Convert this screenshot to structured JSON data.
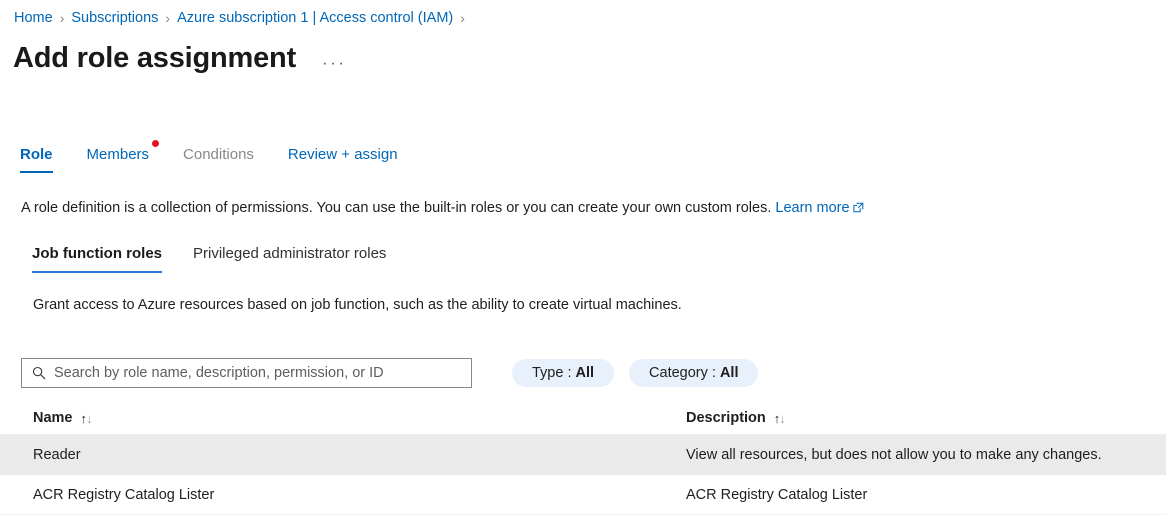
{
  "breadcrumb": {
    "items": [
      {
        "label": "Home"
      },
      {
        "label": "Subscriptions"
      },
      {
        "label": "Azure subscription 1 | Access control (IAM)"
      }
    ],
    "separator": "›"
  },
  "header": {
    "title": "Add role assignment",
    "more_menu": "···"
  },
  "tabs": [
    {
      "label": "Role",
      "state": "selected",
      "badge": false
    },
    {
      "label": "Members",
      "state": "enabled",
      "badge": true
    },
    {
      "label": "Conditions",
      "state": "disabled",
      "badge": false
    },
    {
      "label": "Review + assign",
      "state": "enabled",
      "badge": false
    }
  ],
  "description": {
    "text": "A role definition is a collection of permissions. You can use the built-in roles or you can create your own custom roles.",
    "link_label": "Learn more",
    "link_icon": "external-link-icon"
  },
  "subtabs": [
    {
      "label": "Job function roles",
      "state": "selected"
    },
    {
      "label": "Privileged administrator roles",
      "state": "enabled"
    }
  ],
  "grant_text": "Grant access to Azure resources based on job function, such as the ability to create virtual machines.",
  "search": {
    "placeholder": "Search by role name, description, permission, or ID",
    "value": "",
    "icon": "search-icon"
  },
  "filters": [
    {
      "key": "Type :",
      "value": "All"
    },
    {
      "key": "Category :",
      "value": "All"
    }
  ],
  "table": {
    "columns": [
      {
        "label": "Name",
        "sort": "↑↓"
      },
      {
        "label": "Description",
        "sort": "↑↓"
      }
    ],
    "rows": [
      {
        "name": "Reader",
        "description": "View all resources, but does not allow you to make any changes.",
        "highlighted": true
      },
      {
        "name": "ACR Registry Catalog Lister",
        "description": "ACR Registry Catalog Lister",
        "highlighted": false
      }
    ]
  },
  "colors": {
    "link": "#0067b8",
    "accent_underline": "#2a7ad2",
    "badge_red": "#e81123",
    "pill_bg": "#e8f1fb",
    "row_highlight": "#eaeaea"
  }
}
